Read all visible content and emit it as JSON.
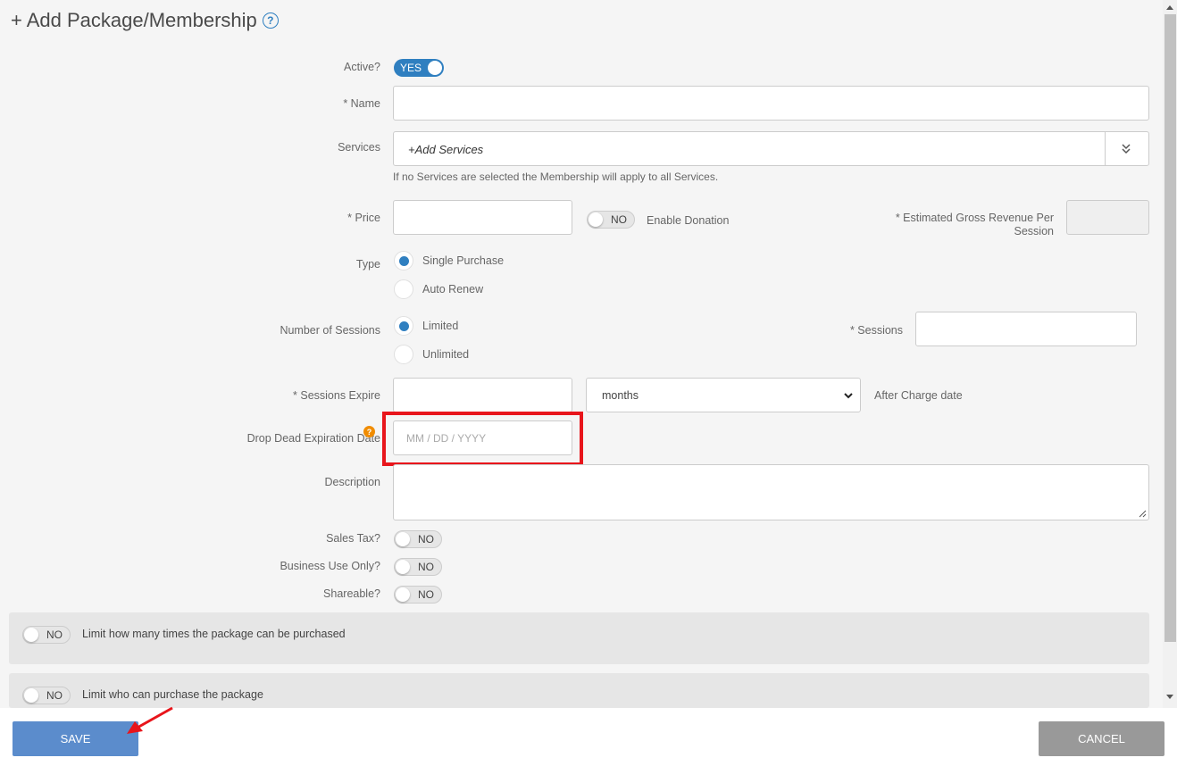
{
  "header": {
    "title": "+ Add Package/Membership",
    "help_icon": "?"
  },
  "form": {
    "active": {
      "label": "Active?",
      "value": "YES"
    },
    "name": {
      "label": "* Name",
      "value": ""
    },
    "services": {
      "label": "Services",
      "placeholder": "+Add Services",
      "hint": "If no Services are selected the Membership will apply to all Services."
    },
    "price": {
      "label": "* Price",
      "value": ""
    },
    "donation": {
      "toggle": "NO",
      "label": "Enable Donation"
    },
    "gross_revenue": {
      "label_line1": "* Estimated Gross Revenue Per",
      "label_line2": "Session",
      "value": ""
    },
    "type": {
      "label": "Type",
      "options": [
        "Single Purchase",
        "Auto Renew"
      ],
      "selected": "Single Purchase"
    },
    "num_sessions": {
      "label": "Number of Sessions",
      "options": [
        "Limited",
        "Unlimited"
      ],
      "selected": "Limited"
    },
    "sessions": {
      "label": "* Sessions",
      "value": ""
    },
    "sessions_expire": {
      "label": "* Sessions Expire",
      "value": "",
      "unit": "months",
      "suffix": "After Charge date"
    },
    "drop_dead": {
      "label": "Drop Dead Expiration Date",
      "placeholder": "MM / DD / YYYY",
      "help_icon": "?"
    },
    "description": {
      "label": "Description",
      "value": ""
    },
    "sales_tax": {
      "label": "Sales Tax?",
      "value": "NO"
    },
    "business_use": {
      "label": "Business Use Only?",
      "value": "NO"
    },
    "shareable": {
      "label": "Shareable?",
      "value": "NO"
    }
  },
  "panels": [
    {
      "toggle": "NO",
      "label": "Limit how many times the package can be purchased"
    },
    {
      "toggle": "NO",
      "label": "Limit who can purchase the package"
    }
  ],
  "footer": {
    "save_label": "SAVE",
    "cancel_label": "CANCEL"
  },
  "colors": {
    "accent": "#2f7fc0",
    "highlight": "#e8151b",
    "save": "#5b8ccc",
    "cancel": "#999999",
    "tooltip": "#f08c00"
  }
}
